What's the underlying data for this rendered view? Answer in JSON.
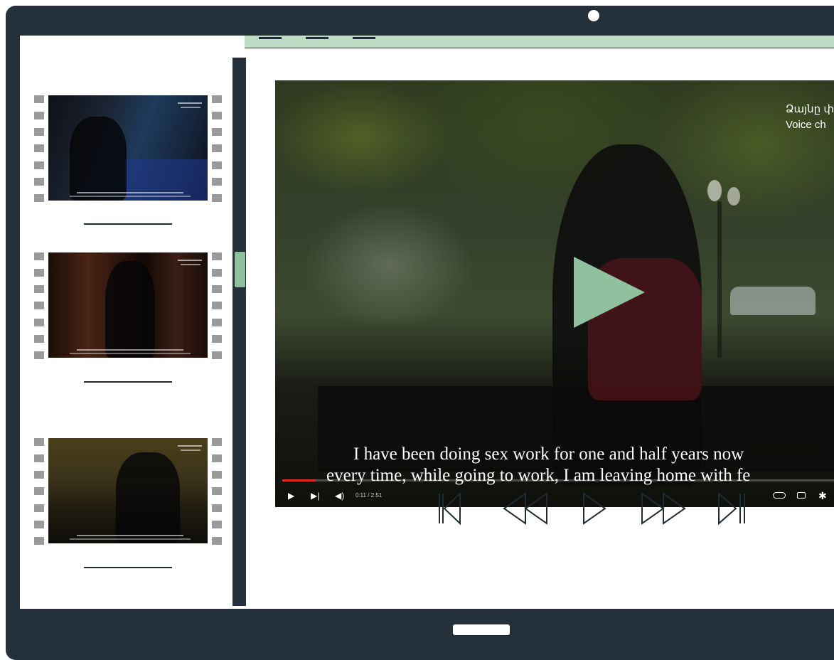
{
  "app": {
    "frame_color": "#25313a",
    "accent_color": "#8fc19e",
    "menubar_color": "#bfdcc4"
  },
  "menubar": {
    "items": [
      "menu-line",
      "menu-line",
      "menu-line"
    ]
  },
  "sidebar": {
    "videos": [
      {
        "id": "video-1",
        "tone": "#1d3b5c"
      },
      {
        "id": "video-2",
        "tone": "#3a1e16"
      },
      {
        "id": "video-3",
        "tone": "#4a3f1a"
      }
    ]
  },
  "player": {
    "channel_label_hy": "Ձայնը փ",
    "channel_label_en": "Voice ch",
    "subtitle_line_1": "I have been doing sex work for one and half years now",
    "subtitle_line_2": "every time, while going to work, I am leaving home with fe",
    "time": "0:11 / 2:51",
    "progress": 0.06
  },
  "transport": {
    "icons": [
      "skip-back-icon",
      "rewind-icon",
      "play-icon",
      "fast-forward-icon",
      "skip-forward-icon"
    ]
  }
}
